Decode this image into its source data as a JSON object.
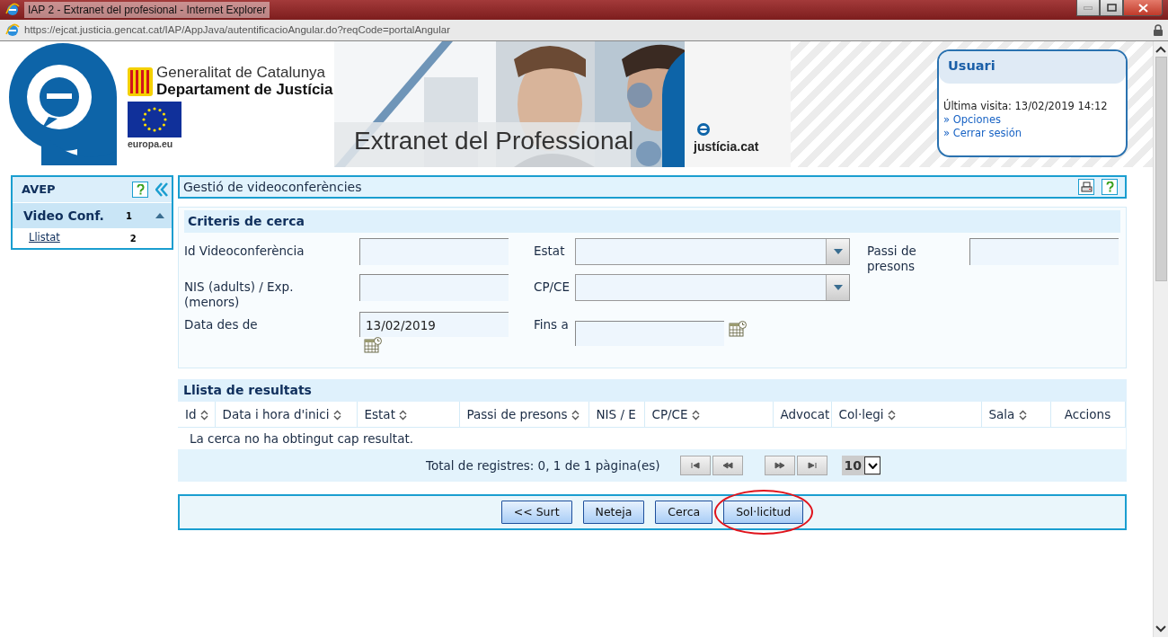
{
  "browser": {
    "title": "IAP 2 - Extranet del profesional - Internet Explorer",
    "url": "https://ejcat.justicia.gencat.cat/IAP/AppJava/autentificacioAngular.do?reqCode=portalAngular"
  },
  "banner": {
    "org_line1": "Generalitat de Catalunya",
    "org_line2": "Departament de Justícia",
    "eu_caption": "europa.eu",
    "title": "Extranet del Professional",
    "brand": "justícia.cat"
  },
  "user_box": {
    "title": "Usuari",
    "last_visit": "Última visita: 13/02/2019 14:12",
    "links": [
      "» Opciones",
      "» Cerrar sesión"
    ]
  },
  "sidebar": {
    "title": "AVEP",
    "items": [
      {
        "label": "Video Conf.",
        "shortcut": "1",
        "expanded": true,
        "children": [
          {
            "label": "Llistat",
            "shortcut": "2"
          }
        ]
      }
    ]
  },
  "page_title": "Gestió de videoconferències",
  "search": {
    "title": "Criteris de cerca",
    "rows": [
      [
        {
          "kind": "text",
          "label": "Id Videoconferència"
        },
        {
          "kind": "select",
          "label": "Estat"
        },
        {
          "kind": "text",
          "label": "Passi de presons"
        }
      ],
      [
        {
          "kind": "text",
          "label": "NIS (adults) / Exp. (menors)"
        },
        {
          "kind": "select",
          "label": "CP/CE"
        }
      ],
      [
        {
          "kind": "date",
          "label": "Data des de",
          "value": "13/02/2019"
        },
        {
          "kind": "date",
          "label": "Fins a"
        }
      ]
    ]
  },
  "results": {
    "title": "Llista de resultats",
    "columns": [
      {
        "label": "Id",
        "sortable": true
      },
      {
        "label": "Data i hora d'inici",
        "sortable": true
      },
      {
        "label": "Estat",
        "sortable": true
      },
      {
        "label": "Passi de presons",
        "sortable": true
      },
      {
        "label": "NIS / E",
        "sortable": false
      },
      {
        "label": "CP/CE",
        "sortable": true
      },
      {
        "label": "Advocat",
        "sortable": false
      },
      {
        "label": "Col·legi",
        "sortable": true
      },
      {
        "label": "Sala",
        "sortable": true
      },
      {
        "label": "Accions",
        "sortable": false
      }
    ],
    "empty_message": "La cerca no ha obtingut cap resultat.",
    "total": "Total de registres: 0, 1 de 1 pàgina(es)",
    "page_size": "10"
  },
  "buttons": [
    {
      "label": "<< Surt",
      "circled": false
    },
    {
      "label": "Neteja",
      "circled": false
    },
    {
      "label": "Cerca",
      "circled": false
    },
    {
      "label": "Sol·licitud",
      "circled": true
    }
  ]
}
